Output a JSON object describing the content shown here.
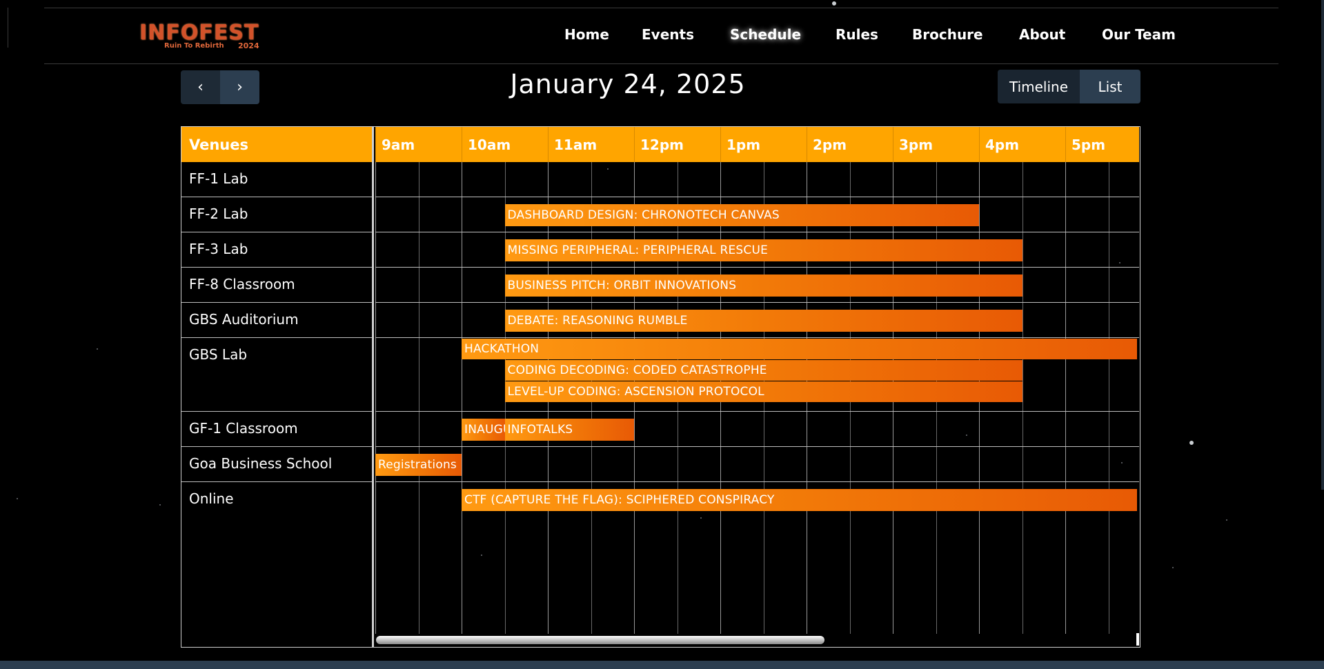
{
  "brand": {
    "name": "INFOFEST",
    "tagline": "Ruin To Rebirth",
    "year": "2024"
  },
  "nav": {
    "items": [
      {
        "label": "Home"
      },
      {
        "label": "Events"
      },
      {
        "label": "Schedule",
        "active": true
      },
      {
        "label": "Rules"
      },
      {
        "label": "Brochure"
      },
      {
        "label": "About"
      },
      {
        "label": "Our Team"
      }
    ]
  },
  "toolbar": {
    "prev_icon": "chevron-left-icon",
    "next_icon": "chevron-right-icon",
    "prev_glyph": "‹",
    "next_glyph": "›",
    "date": "January 24, 2025",
    "views": [
      {
        "label": "Timeline",
        "active": true
      },
      {
        "label": "List",
        "active": false
      }
    ]
  },
  "schedule": {
    "venues_header": "Venues",
    "hours": [
      "9am",
      "10am",
      "11am",
      "12pm",
      "1pm",
      "2pm",
      "3pm",
      "4pm",
      "5pm"
    ],
    "venues": [
      "FF-1 Lab",
      "FF-2 Lab",
      "FF-3 Lab",
      "FF-8 Classroom",
      "GBS Auditorium",
      "GBS Lab",
      "GF-1 Classroom",
      "Goa Business School",
      "Online"
    ],
    "events": [
      {
        "title": "DASHBOARD DESIGN: CHRONOTECH CANVAS",
        "venue": "FF-2 Lab",
        "start": "10:30",
        "end": "16:00"
      },
      {
        "title": "MISSING PERIPHERAL: PERIPHERAL RESCUE",
        "venue": "FF-3 Lab",
        "start": "10:30",
        "end": "16:30"
      },
      {
        "title": "BUSINESS PITCH: ORBIT INNOVATIONS",
        "venue": "FF-8 Classroom",
        "start": "10:30",
        "end": "16:30"
      },
      {
        "title": "DEBATE: REASONING RUMBLE",
        "venue": "GBS Auditorium",
        "start": "10:30",
        "end": "16:30"
      },
      {
        "title": "HACKATHON",
        "venue": "GBS Lab",
        "start": "10:00",
        "end": "17:50"
      },
      {
        "title": "CODING DECODING: CODED CATASTROPHE",
        "venue": "GBS Lab",
        "start": "10:30",
        "end": "16:30"
      },
      {
        "title": "LEVEL-UP CODING: ASCENSION PROTOCOL",
        "venue": "GBS Lab",
        "start": "10:30",
        "end": "16:30"
      },
      {
        "title": "INAUGURATION",
        "venue": "GF-1 Classroom",
        "start": "10:00",
        "end": "10:30"
      },
      {
        "title": "INFOTALKS",
        "venue": "GF-1 Classroom",
        "start": "10:30",
        "end": "12:00"
      },
      {
        "title": "Registrations",
        "venue": "Goa Business School",
        "start": "09:00",
        "end": "10:00"
      },
      {
        "title": "CTF (CAPTURE THE FLAG): SCIPHERED CONSPIRACY",
        "venue": "Online",
        "start": "10:00",
        "end": "17:50"
      }
    ]
  }
}
